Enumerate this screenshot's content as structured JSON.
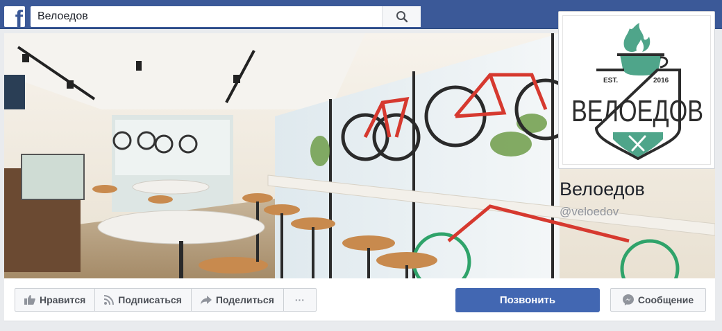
{
  "search": {
    "query": "Велоедов"
  },
  "page": {
    "name": "Велоедов",
    "handle": "@veloedov"
  },
  "logo": {
    "est": "EST.",
    "year": "2016",
    "wordmark": "ВЕЛОЕДОВ"
  },
  "actions": {
    "like": "Нравится",
    "subscribe": "Подписаться",
    "share": "Поделиться",
    "more": "···",
    "call": "Позвонить",
    "message": "Сообщение"
  },
  "colors": {
    "brand": "#3b5998",
    "call_button": "#4267b2",
    "logo_green": "#4fa58a",
    "logo_dark": "#2c2c2c"
  },
  "icons": [
    "facebook-logo-icon",
    "search-icon",
    "like-icon",
    "rss-icon",
    "share-icon",
    "messenger-icon"
  ]
}
